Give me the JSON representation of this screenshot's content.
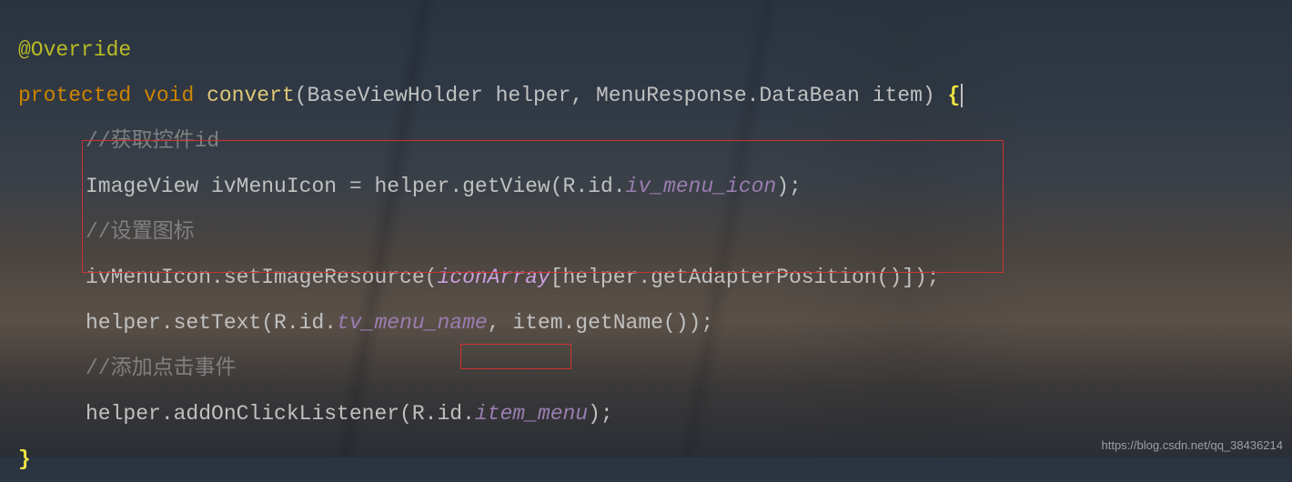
{
  "code": {
    "annotation": "@Override",
    "sig": {
      "modifier": "protected",
      "return_type": "void",
      "method_name": "convert",
      "param1_type": "BaseViewHolder",
      "param1_name": "helper",
      "param2_type": "MenuResponse.DataBean",
      "param2_name": "item",
      "open_brace": "{"
    },
    "line3_comment": "//获取控件id",
    "line4": {
      "type": "ImageView",
      "var": "ivMenuIcon",
      "assign": " = ",
      "call": "helper.getView(R.id.",
      "ref": "iv_menu_icon",
      "end": ");"
    },
    "line5_comment": "//设置图标",
    "line6": {
      "pre": "ivMenuIcon.setImageResource(",
      "field": "iconArray",
      "post": "[helper.getAdapterPosition()]);"
    },
    "line7": {
      "pre": "helper.setText(R.id.",
      "ref": "tv_menu_name",
      "mid": ", item.getName());"
    },
    "line8_comment": "//添加点击事件",
    "line9": {
      "pre": "helper.addOnClickListener(R.id.",
      "ref": "item_menu",
      "end": ");"
    },
    "close_brace": "}"
  },
  "watermark": "https://blog.csdn.net/qq_38436214"
}
